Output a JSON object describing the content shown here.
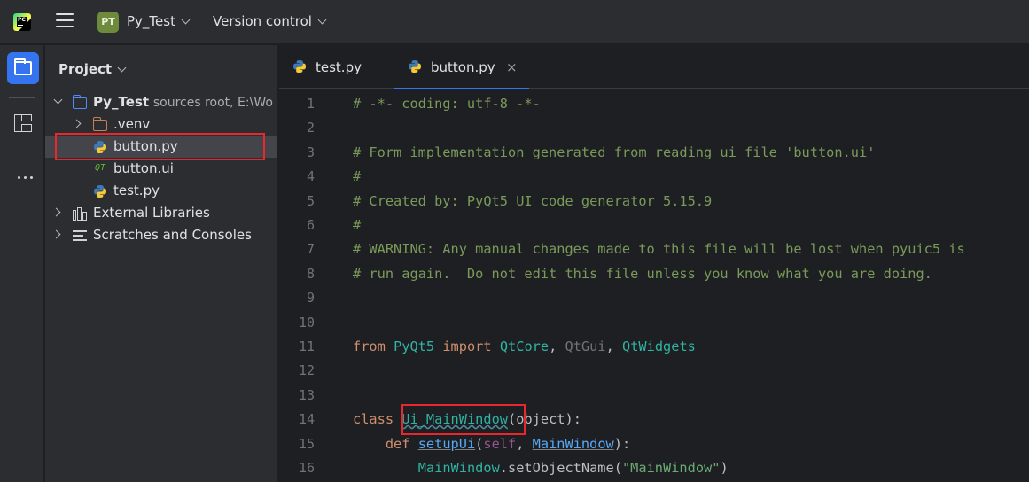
{
  "titlebar": {
    "logo_icon": "pycharm-logo-icon",
    "logo_text": "PC",
    "project_badge": "PT",
    "project_name": "Py_Test",
    "vcs_label": "Version control"
  },
  "toolstrip": {
    "items": [
      "project-folder-icon",
      "structure-icon",
      "more-dots-icon"
    ]
  },
  "project_panel": {
    "title": "Project",
    "root": {
      "name": "Py_Test",
      "hint": "sources root,  E:\\Wo"
    },
    "venv": ".venv",
    "files": [
      "button.py",
      "button.ui",
      "test.py"
    ],
    "external_libraries": "External Libraries",
    "scratches": "Scratches and Consoles",
    "selected": "button.py"
  },
  "editor": {
    "tabs": [
      {
        "label": "test.py",
        "active": false
      },
      {
        "label": "button.py",
        "active": true,
        "close": "×"
      }
    ],
    "line_numbers": [
      "1",
      "2",
      "3",
      "4",
      "5",
      "6",
      "7",
      "8",
      "9",
      "10",
      "11",
      "12",
      "13",
      "14",
      "15",
      "16"
    ],
    "lines": {
      "l1": "# -*- coding: utf-8 -*-",
      "l3": "# Form implementation generated from reading ui file 'button.ui'",
      "l4": "#",
      "l5": "# Created by: PyQt5 UI code generator 5.15.9",
      "l6": "#",
      "l7": "# WARNING: Any manual changes made to this file will be lost when pyuic5 is",
      "l8": "# run again.  Do not edit this file unless you know what you are doing.",
      "l11_from": "from",
      "l11_mod": "PyQt5",
      "l11_import": "import",
      "l11_a": "QtCore",
      "l11_comma1": ", ",
      "l11_b": "QtGui",
      "l11_comma2": ", ",
      "l11_c": "QtWidgets",
      "l14_class": "class",
      "l14_name": "Ui_MainWindow",
      "l14_rest": "(object):",
      "l15_def": "def",
      "l15_name": "setupUi",
      "l15_open": "(",
      "l15_self": "self",
      "l15_sep": ", ",
      "l15_param": "MainWindow",
      "l15_close": "):",
      "l16_obj": "MainWindow",
      "l16_call": ".setObjectName(",
      "l16_str": "\"MainWindow\"",
      "l16_close": ")"
    }
  },
  "colors": {
    "accent": "#3574f0",
    "highlight_box": "#e8282c",
    "comment": "#7a9a5a",
    "keyword": "#cf8e6d"
  }
}
